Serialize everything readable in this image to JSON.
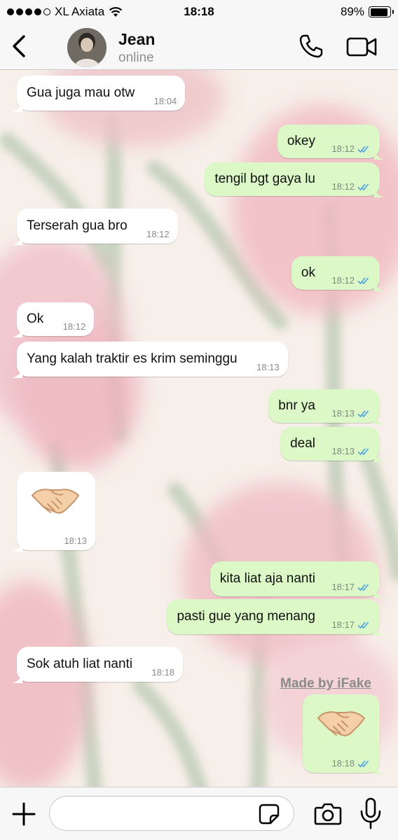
{
  "status_bar": {
    "carrier": "XL Axiata",
    "time": "18:18",
    "battery": "89%",
    "battery_level": 0.89
  },
  "header": {
    "contact_name": "Jean",
    "contact_status": "online"
  },
  "messages": [
    {
      "dir": "in",
      "text": "Gua juga mau otw",
      "time": "18:04"
    },
    {
      "dir": "out",
      "text": "okey",
      "time": "18:12",
      "read": true
    },
    {
      "dir": "out",
      "text": "tengil bgt gaya lu",
      "time": "18:12",
      "read": true
    },
    {
      "dir": "in",
      "text": "Terserah gua bro",
      "time": "18:12"
    },
    {
      "dir": "out",
      "text": "ok",
      "time": "18:12",
      "read": true
    },
    {
      "dir": "in",
      "text": "Ok",
      "time": "18:12"
    },
    {
      "dir": "in",
      "text": "Yang kalah traktir es krim seminggu",
      "time": "18:13"
    },
    {
      "dir": "out",
      "text": "bnr ya",
      "time": "18:13",
      "read": true
    },
    {
      "dir": "out",
      "text": "deal",
      "time": "18:13",
      "read": true
    },
    {
      "dir": "in",
      "text": "🤝",
      "time": "18:13",
      "emoji": true
    },
    {
      "dir": "out",
      "text": "kita liat aja nanti",
      "time": "18:17",
      "read": true
    },
    {
      "dir": "out",
      "text": "pasti gue yang menang",
      "time": "18:17",
      "read": true
    },
    {
      "dir": "in",
      "text": "Sok atuh liat nanti",
      "time": "18:18"
    },
    {
      "dir": "out",
      "text": "🤝",
      "time": "18:18",
      "read": true,
      "emoji": true
    }
  ],
  "watermark": "Made by iFake",
  "input": {
    "placeholder": ""
  },
  "colors": {
    "incoming_bubble": "#ffffff",
    "outgoing_bubble": "#dcf8c6",
    "read_tick": "#4fa3e0",
    "bar_background": "#f7f7f7"
  },
  "icons": [
    "back-icon",
    "phone-icon",
    "video-call-icon",
    "plus-icon",
    "sticker-icon",
    "camera-icon",
    "microphone-icon",
    "double-check-icon"
  ]
}
